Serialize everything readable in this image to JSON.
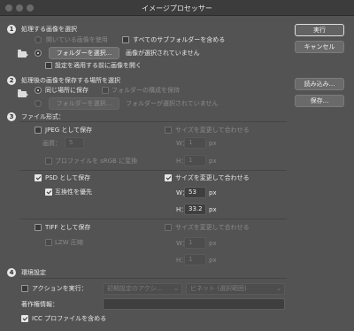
{
  "window": {
    "title": "イメージプロセッサー"
  },
  "buttons": {
    "run": "実行",
    "cancel": "キャンセル",
    "load": "読み込み...",
    "save": "保存..."
  },
  "section1": {
    "number": "1",
    "title": "処理する画像を選択",
    "use_open_images": "開いている画像を使用",
    "include_subfolders": "すべてのサブフォルダーを含める",
    "select_folder_button": "フォルダーを選択...",
    "no_folder_text": "画像が選択されていません",
    "open_first_image": "設定を適用する前に画像を開く"
  },
  "section2": {
    "number": "2",
    "title": "処理後の画像を保存する場所を選択",
    "save_same_location": "同じ場所に保存",
    "keep_structure": "フォルダーの構成を保持",
    "select_folder_button": "フォルダーを選択...",
    "no_folder_text": "フォルダーが選択されていません"
  },
  "section3": {
    "number": "3",
    "title": "ファイル形式：",
    "jpeg": {
      "label": "JPEG として保存",
      "resize": "サイズを変更して合わせる",
      "quality_label": "画質：",
      "quality_value": "5",
      "convert_srgb": "プロファイルを sRGB に変換",
      "w_label": "W：",
      "h_label": "H：",
      "w_value": "1",
      "h_value": "1",
      "unit": "px"
    },
    "psd": {
      "label": "PSD として保存",
      "resize": "サイズを変更して合わせる",
      "maximize_compat": "互換性を優先",
      "w_label": "W：",
      "h_label": "H：",
      "w_value": "53",
      "h_value": "33.2",
      "unit": "px"
    },
    "tiff": {
      "label": "TIFF として保存",
      "resize": "サイズを変更して合わせる",
      "lzw": "LZW 圧縮",
      "w_label": "W：",
      "h_label": "H：",
      "w_value": "1",
      "h_value": "1",
      "unit": "px"
    }
  },
  "section4": {
    "number": "4",
    "title": "環境設定",
    "run_action": "アクションを実行：",
    "action_set": "初期設定のアクシ...",
    "action_name": "ビネット (選択範囲)",
    "copyright_label": "著作権情報：",
    "copyright_value": "",
    "include_icc": "ICC プロファイルを含める"
  }
}
